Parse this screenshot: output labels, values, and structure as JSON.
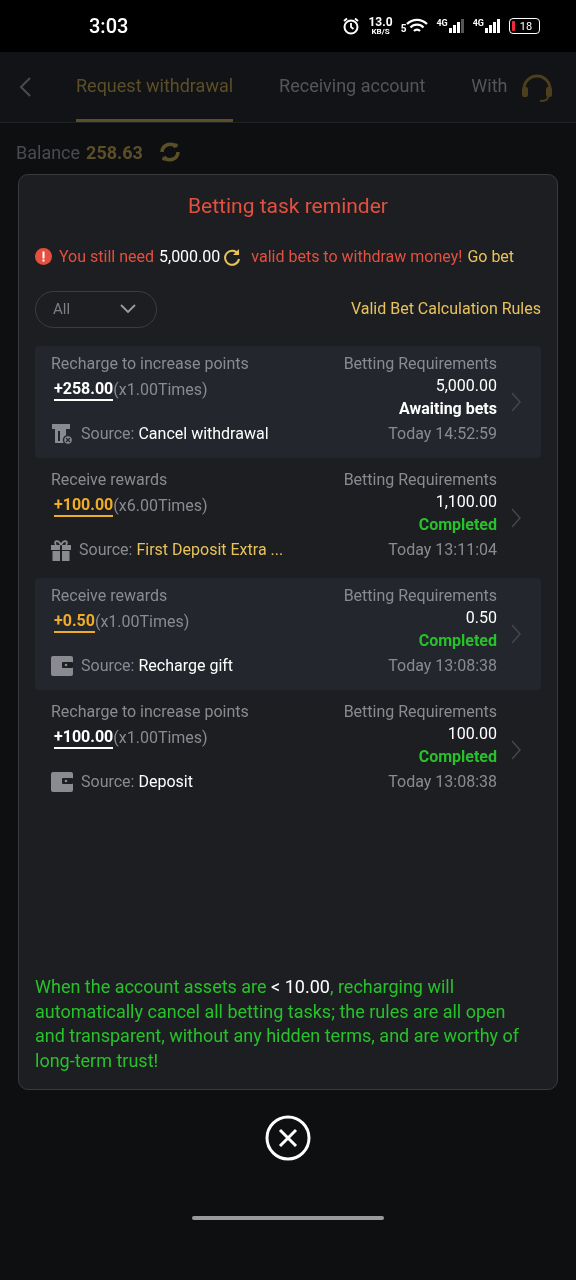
{
  "status_bar": {
    "time": "3:03",
    "speed_value": "13.0",
    "speed_unit": "KB/S",
    "wifi_label": "5",
    "sim_labels": [
      "4G",
      "4G"
    ],
    "battery": "18"
  },
  "page": {
    "tabs": [
      {
        "label": "Request withdrawal",
        "selected": true
      },
      {
        "label": "Receiving account",
        "selected": false
      },
      {
        "label": "With",
        "selected": false
      }
    ],
    "balance_label": "Balance",
    "balance_value": "258.63"
  },
  "dialog": {
    "title": "Betting task reminder",
    "notice_before": "You still need",
    "notice_amount": "5,000.00",
    "notice_after": "valid bets to withdraw money!",
    "go_bet": "Go bet",
    "filter": "All",
    "rules_link": "Valid Bet Calculation Rules",
    "tasks": [
      {
        "type": "Recharge to increase points",
        "kind": "recharge",
        "amount": "+258.00",
        "multiplier": "(x1.00Times)",
        "source_label": "Source:",
        "source": {
          "kind": "atm",
          "text": "Cancel withdrawal",
          "color": "#ffffff"
        },
        "req_label": "Betting Requirements",
        "req_value": "5,000.00",
        "status": {
          "text": "Awaiting bets",
          "color": "#ffffff"
        },
        "time": "Today 14:52:59"
      },
      {
        "type": "Receive rewards",
        "kind": "reward",
        "amount": "+100.00",
        "multiplier": "(x6.00Times)",
        "source_label": "Source:",
        "source": {
          "kind": "gift",
          "text": "First Deposit Extra ...",
          "color": "#e8c35a"
        },
        "req_label": "Betting Requirements",
        "req_value": "1,100.00",
        "status": {
          "text": "Completed",
          "color": "#27c22a"
        },
        "time": "Today 13:11:04"
      },
      {
        "type": "Receive rewards",
        "kind": "reward",
        "amount": "+0.50",
        "multiplier": "(x1.00Times)",
        "source_label": "Source:",
        "source": {
          "kind": "wallet",
          "text": "Recharge gift",
          "color": "#ffffff"
        },
        "req_label": "Betting Requirements",
        "req_value": "0.50",
        "status": {
          "text": "Completed",
          "color": "#27c22a"
        },
        "time": "Today 13:08:38"
      },
      {
        "type": "Recharge to increase points",
        "kind": "recharge",
        "amount": "+100.00",
        "multiplier": "(x1.00Times)",
        "source_label": "Source:",
        "source": {
          "kind": "wallet",
          "text": "Deposit",
          "color": "#ffffff"
        },
        "req_label": "Betting Requirements",
        "req_value": "100.00",
        "status": {
          "text": "Completed",
          "color": "#27c22a"
        },
        "time": "Today 13:08:38"
      }
    ],
    "note_before": "When the account assets are",
    "note_value": "< 10.00",
    "note_after": ", recharging will automatically cancel all betting tasks; the rules are all open and transparent, without any hidden terms, and are worthy of long-term trust!"
  }
}
